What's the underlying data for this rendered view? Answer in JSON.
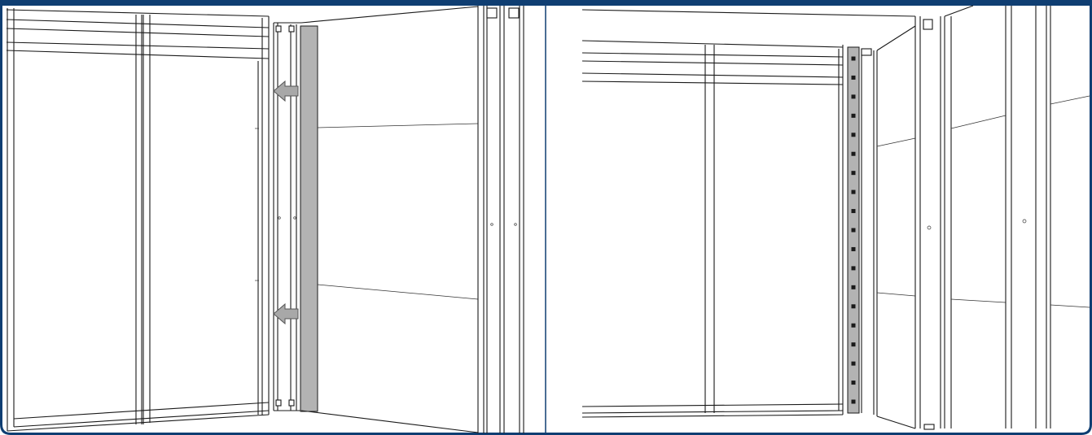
{
  "colors": {
    "frame_border": "#0f3e72",
    "line": "#1a1a1a",
    "highlight_panel": "#b3b3b3",
    "arrow_fill": "#a8a8a8",
    "background": "#ffffff"
  },
  "left_view": {
    "arrows": [
      {
        "name": "upper-arrow-icon",
        "direction": "left"
      },
      {
        "name": "lower-arrow-icon",
        "direction": "left"
      }
    ],
    "highlighted_part": "vertical-cover-strip"
  },
  "right_view": {
    "screw_count": 19,
    "highlighted_part": "vertical-screw-strip"
  }
}
